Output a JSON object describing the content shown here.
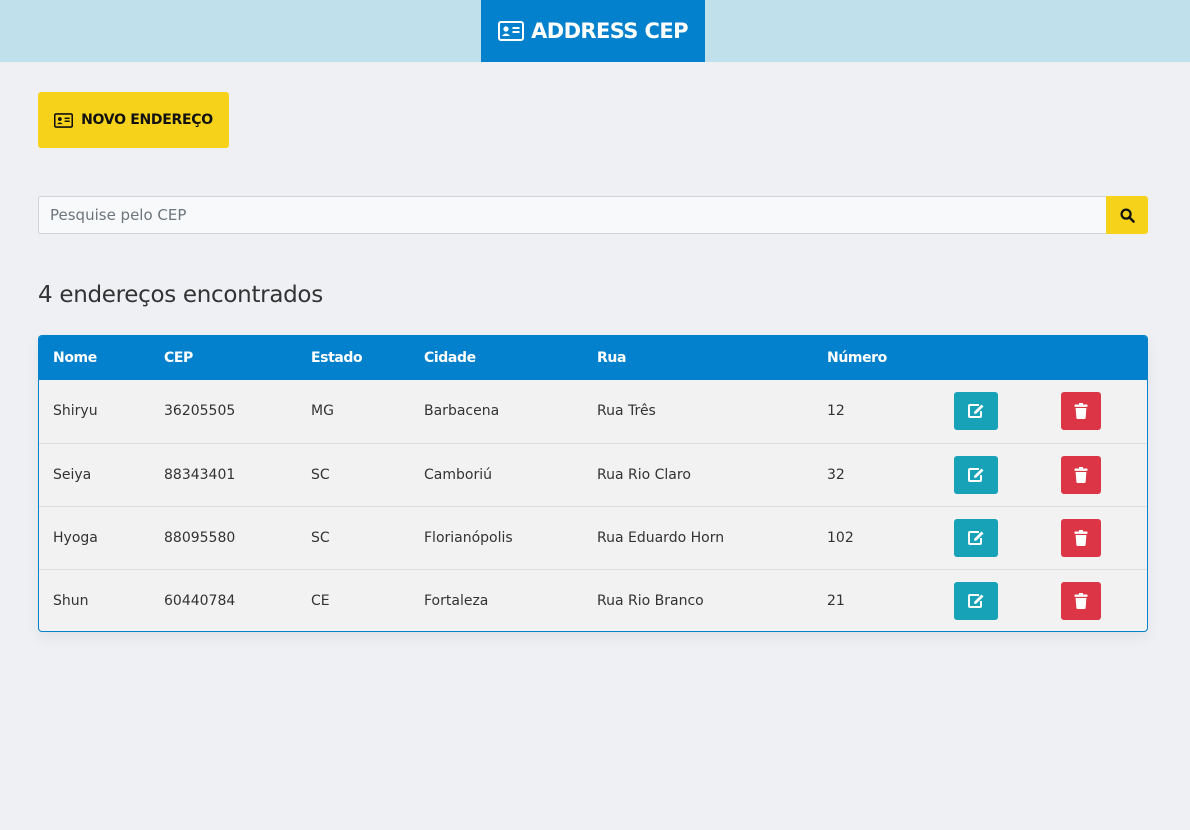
{
  "header": {
    "brand_label": "ADDRESS CEP",
    "brand_icon": "address-card-icon",
    "bar_color": "#c0e0eb",
    "brand_color": "#0481cd"
  },
  "new_button": {
    "label": "NOVO ENDEREÇO",
    "icon": "address-card-icon",
    "color": "#f7d21a"
  },
  "search": {
    "placeholder": "Pesquise pelo CEP",
    "value": "",
    "button_icon": "search-icon"
  },
  "results": {
    "title": "4 endereços encontrados"
  },
  "table": {
    "headers": {
      "nome": "Nome",
      "cep": "CEP",
      "estado": "Estado",
      "cidade": "Cidade",
      "rua": "Rua",
      "numero": "Número"
    },
    "rows": [
      {
        "nome": "Shiryu",
        "cep": "36205505",
        "estado": "MG",
        "cidade": "Barbacena",
        "rua": "Rua Três",
        "numero": "12"
      },
      {
        "nome": "Seiya",
        "cep": "88343401",
        "estado": "SC",
        "cidade": "Camboriú",
        "rua": "Rua Rio Claro",
        "numero": "32"
      },
      {
        "nome": "Hyoga",
        "cep": "88095580",
        "estado": "SC",
        "cidade": "Florianópolis",
        "rua": "Rua Eduardo Horn",
        "numero": "102"
      },
      {
        "nome": "Shun",
        "cep": "60440784",
        "estado": "CE",
        "cidade": "Fortaleza",
        "rua": "Rua Rio Branco",
        "numero": "21"
      }
    ],
    "edit_icon": "edit-icon",
    "delete_icon": "trash-icon",
    "edit_color": "#17a2b8",
    "delete_color": "#dc3545"
  }
}
